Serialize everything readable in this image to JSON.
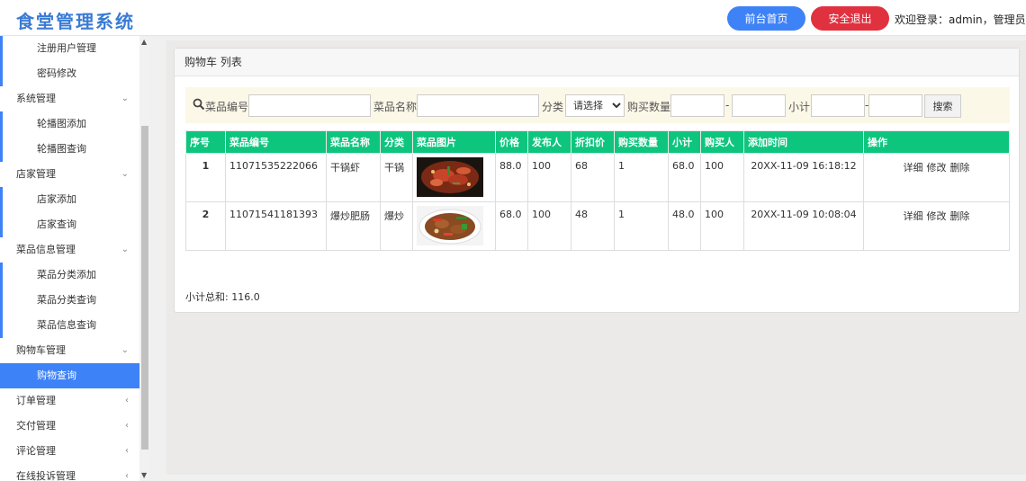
{
  "header": {
    "brand": "食堂管理系统",
    "home_button": "前台首页",
    "logout_button": "安全退出",
    "welcome": "欢迎登录：admin，管理员"
  },
  "sidebar": {
    "items": [
      {
        "label": "注册用户管理",
        "kind": "sub"
      },
      {
        "label": "密码修改",
        "kind": "sub"
      },
      {
        "label": "系统管理",
        "kind": "parent",
        "arrow": "down"
      },
      {
        "label": "轮播图添加",
        "kind": "sub"
      },
      {
        "label": "轮播图查询",
        "kind": "sub"
      },
      {
        "label": "店家管理",
        "kind": "parent",
        "arrow": "down"
      },
      {
        "label": "店家添加",
        "kind": "sub"
      },
      {
        "label": "店家查询",
        "kind": "sub"
      },
      {
        "label": "菜品信息管理",
        "kind": "parent",
        "arrow": "down"
      },
      {
        "label": "菜品分类添加",
        "kind": "sub"
      },
      {
        "label": "菜品分类查询",
        "kind": "sub"
      },
      {
        "label": "菜品信息查询",
        "kind": "sub"
      },
      {
        "label": "购物车管理",
        "kind": "parent",
        "arrow": "down"
      },
      {
        "label": "购物查询",
        "kind": "sub",
        "active": true
      },
      {
        "label": "订单管理",
        "kind": "parent",
        "arrow": "left"
      },
      {
        "label": "交付管理",
        "kind": "parent",
        "arrow": "left"
      },
      {
        "label": "评论管理",
        "kind": "parent",
        "arrow": "left"
      },
      {
        "label": "在线投诉管理",
        "kind": "parent",
        "arrow": "left"
      }
    ]
  },
  "panel": {
    "title": "购物车 列表"
  },
  "search": {
    "dish_code_label": "菜品编号",
    "dish_name_label": "菜品名称",
    "category_label": "分类",
    "category_selected": "请选择",
    "quantity_label": "购买数量",
    "range_sep": "-",
    "subtotal_label": "小计",
    "button": "搜索"
  },
  "table": {
    "headers": [
      "序号",
      "菜品编号",
      "菜品名称",
      "分类",
      "菜品图片",
      "价格",
      "发布人",
      "折扣价",
      "购买数量",
      "小计",
      "购买人",
      "添加时间",
      "操作"
    ],
    "rows": [
      {
        "no": "1",
        "code": "11071535222066",
        "name": "干锅虾",
        "category": "干锅",
        "price": "88.0",
        "publisher": "100",
        "discount": "68",
        "qty": "1",
        "subtotal": "68.0",
        "buyer": "100",
        "time": "20XX-11-09 16:18:12"
      },
      {
        "no": "2",
        "code": "11071541181393",
        "name": "爆炒肥肠",
        "category": "爆炒",
        "price": "68.0",
        "publisher": "100",
        "discount": "48",
        "qty": "1",
        "subtotal": "48.0",
        "buyer": "100",
        "time": "20XX-11-09 10:08:04"
      }
    ],
    "actions": {
      "detail": "详细",
      "edit": "修改",
      "delete": "删除"
    }
  },
  "summary": "小计总和: 116.0"
}
